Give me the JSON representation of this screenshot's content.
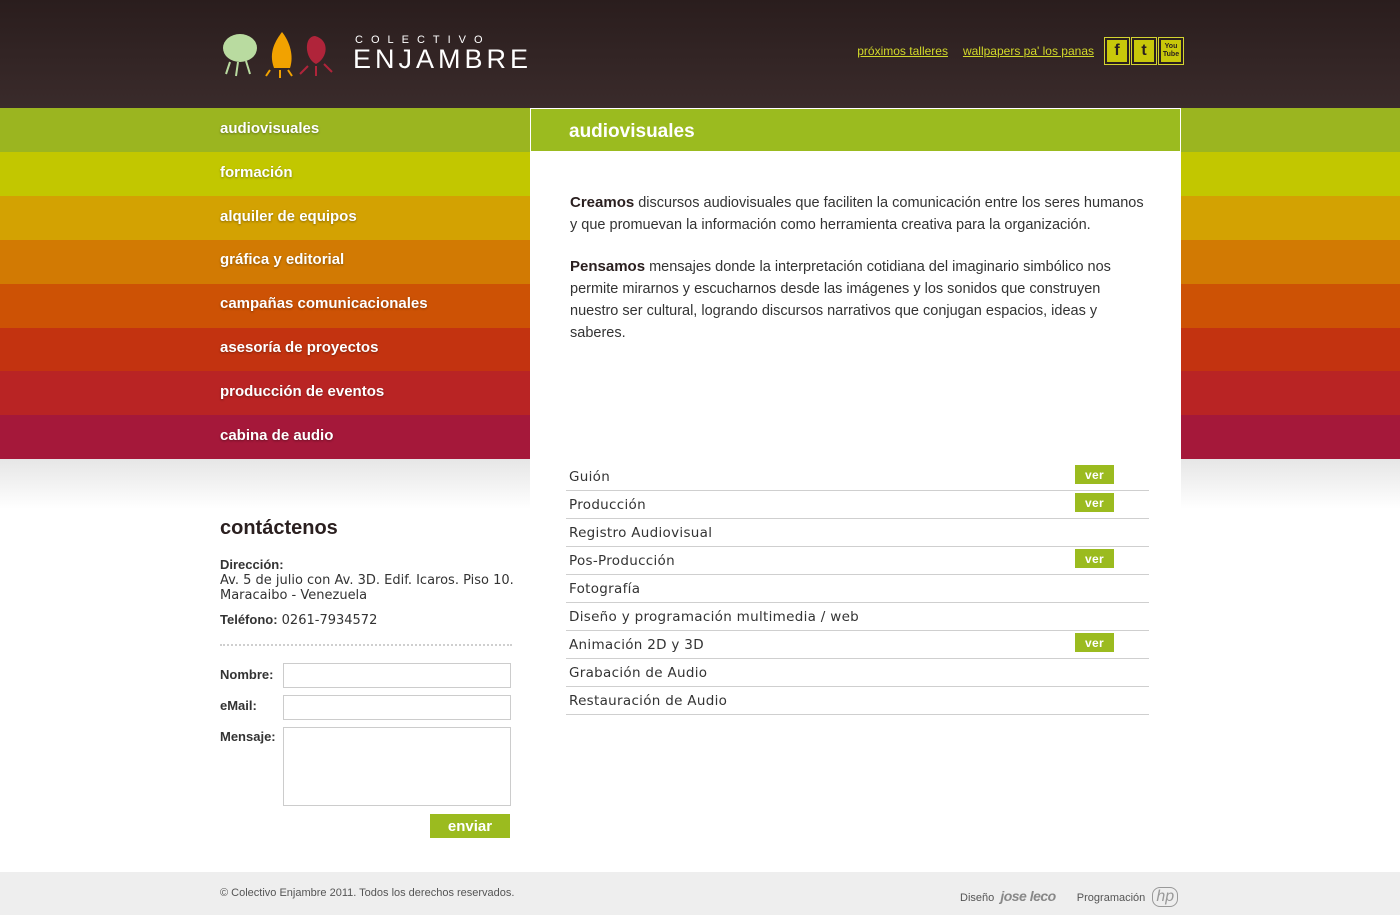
{
  "header": {
    "logo_small": "COLECTIVO",
    "logo_big": "ENJAMBRE",
    "links": [
      "próximos talleres",
      "wallpapers pa' los panas"
    ],
    "social": [
      {
        "name": "facebook-icon",
        "label": "f"
      },
      {
        "name": "twitter-icon",
        "label": "t"
      },
      {
        "name": "youtube-icon",
        "label": "You Tube"
      }
    ]
  },
  "nav": [
    {
      "label": "audiovisuales",
      "color": "#9bb520"
    },
    {
      "label": "formación",
      "color": "#c2c700"
    },
    {
      "label": "alquiler de equipos",
      "color": "#d3a202"
    },
    {
      "label": "gráfica y editorial",
      "color": "#d27a03"
    },
    {
      "label": "campañas comunicacionales",
      "color": "#cd5205"
    },
    {
      "label": "asesoría de proyectos",
      "color": "#c33310"
    },
    {
      "label": "producción de eventos",
      "color": "#b92424"
    },
    {
      "label": "cabina de audio",
      "color": "#a5183a"
    }
  ],
  "panel": {
    "title": "audiovisuales",
    "para1_bold": "Creamos",
    "para1_text": " discursos audiovisuales que faciliten la comunicación entre los seres humanos y que promuevan la información como herramienta creativa para la organización.",
    "para2_bold": "Pensamos",
    "para2_text": " mensajes donde la interpretación cotidiana del imaginario simbólico nos permite mirarnos y escucharnos desde las imágenes y los sonidos que construyen nuestro ser cultural, logrando discursos narrativos que conjugan espacios, ideas y saberes.",
    "ver_label": "ver",
    "services": [
      {
        "label": "Guión",
        "ver": true
      },
      {
        "label": "Producción",
        "ver": true
      },
      {
        "label": "Registro Audiovisual",
        "ver": false
      },
      {
        "label": "Pos-Producción",
        "ver": true
      },
      {
        "label": "Fotografía",
        "ver": false
      },
      {
        "label": "Diseño y programación multimedia / web",
        "ver": false
      },
      {
        "label": "Animación 2D y 3D",
        "ver": true
      },
      {
        "label": "Grabación de Audio",
        "ver": false
      },
      {
        "label": "Restauración de Audio",
        "ver": false
      }
    ]
  },
  "contact": {
    "title": "contáctenos",
    "address_label": "Dirección:",
    "address_line1": "Av. 5 de julio con Av. 3D. Edif. Icaros. Piso 10.",
    "address_line2": "Maracaibo - Venezuela",
    "phone_label": "Teléfono:",
    "phone_value": " 0261-7934572",
    "name_label": "Nombre:",
    "email_label": "eMail:",
    "message_label": "Mensaje:",
    "send_label": "enviar"
  },
  "footer": {
    "copyright": "© Colectivo Enjambre 2011. Todos los derechos reservados.",
    "design_label": "Diseño",
    "design_signature": "jose leco",
    "programming_label": "Programación",
    "programming_mark": "hp"
  }
}
